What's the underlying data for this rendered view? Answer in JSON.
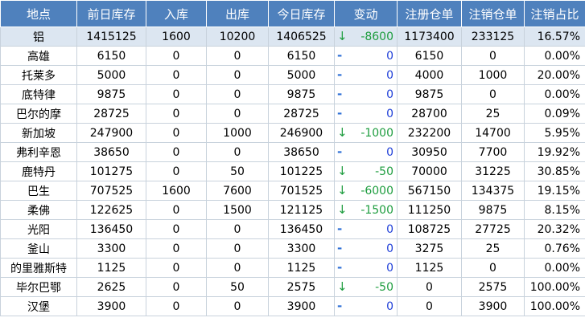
{
  "colors": {
    "header_bg": "#4f81bd",
    "header_text": "#ffffff",
    "highlight_row_bg": "#dce6f1",
    "grid_line": "#c8d2dc",
    "decrease_green": "#1e9d3f",
    "zero_blue": "#1f3fd8"
  },
  "headers": [
    "地点",
    "前日库存",
    "入库",
    "出库",
    "今日库存",
    "变动",
    "注册仓单",
    "注销仓单",
    "注销占比"
  ],
  "rows": [
    {
      "location": "铝",
      "prev": "1415125",
      "in": "1600",
      "out": "10200",
      "today": "1406525",
      "arrow": "↓",
      "arrow_icon": "down-arrow-icon",
      "change": "-8600",
      "registered": "1173400",
      "cancelled": "233125",
      "ratio": "16.57%"
    },
    {
      "location": "高雄",
      "prev": "6150",
      "in": "0",
      "out": "0",
      "today": "6150",
      "arrow": "-",
      "arrow_icon": "dash-icon",
      "change": "0",
      "registered": "6150",
      "cancelled": "0",
      "ratio": "0.00%"
    },
    {
      "location": "托莱多",
      "prev": "5000",
      "in": "0",
      "out": "0",
      "today": "5000",
      "arrow": "-",
      "arrow_icon": "dash-icon",
      "change": "0",
      "registered": "4000",
      "cancelled": "1000",
      "ratio": "20.00%"
    },
    {
      "location": "底特律",
      "prev": "9875",
      "in": "0",
      "out": "0",
      "today": "9875",
      "arrow": "-",
      "arrow_icon": "dash-icon",
      "change": "0",
      "registered": "9875",
      "cancelled": "0",
      "ratio": "0.00%"
    },
    {
      "location": "巴尔的摩",
      "prev": "28725",
      "in": "0",
      "out": "0",
      "today": "28725",
      "arrow": "-",
      "arrow_icon": "dash-icon",
      "change": "0",
      "registered": "28700",
      "cancelled": "25",
      "ratio": "0.09%"
    },
    {
      "location": "新加坡",
      "prev": "247900",
      "in": "0",
      "out": "1000",
      "today": "246900",
      "arrow": "↓",
      "arrow_icon": "down-arrow-icon",
      "change": "-1000",
      "registered": "232200",
      "cancelled": "14700",
      "ratio": "5.95%"
    },
    {
      "location": "弗利辛恩",
      "prev": "38650",
      "in": "0",
      "out": "0",
      "today": "38650",
      "arrow": "-",
      "arrow_icon": "dash-icon",
      "change": "0",
      "registered": "30950",
      "cancelled": "7700",
      "ratio": "19.92%"
    },
    {
      "location": "鹿特丹",
      "prev": "101275",
      "in": "0",
      "out": "50",
      "today": "101225",
      "arrow": "↓",
      "arrow_icon": "down-arrow-icon",
      "change": "-50",
      "registered": "70000",
      "cancelled": "31225",
      "ratio": "30.85%"
    },
    {
      "location": "巴生",
      "prev": "707525",
      "in": "1600",
      "out": "7600",
      "today": "701525",
      "arrow": "↓",
      "arrow_icon": "down-arrow-icon",
      "change": "-6000",
      "registered": "567150",
      "cancelled": "134375",
      "ratio": "19.15%"
    },
    {
      "location": "柔佛",
      "prev": "122625",
      "in": "0",
      "out": "1500",
      "today": "121125",
      "arrow": "↓",
      "arrow_icon": "down-arrow-icon",
      "change": "-1500",
      "registered": "111250",
      "cancelled": "9875",
      "ratio": "8.15%"
    },
    {
      "location": "光阳",
      "prev": "136450",
      "in": "0",
      "out": "0",
      "today": "136450",
      "arrow": "-",
      "arrow_icon": "dash-icon",
      "change": "0",
      "registered": "108725",
      "cancelled": "27725",
      "ratio": "20.32%"
    },
    {
      "location": "釜山",
      "prev": "3300",
      "in": "0",
      "out": "0",
      "today": "3300",
      "arrow": "-",
      "arrow_icon": "dash-icon",
      "change": "0",
      "registered": "3275",
      "cancelled": "25",
      "ratio": "0.76%"
    },
    {
      "location": "的里雅斯特",
      "prev": "1125",
      "in": "0",
      "out": "0",
      "today": "1125",
      "arrow": "-",
      "arrow_icon": "dash-icon",
      "change": "0",
      "registered": "1125",
      "cancelled": "0",
      "ratio": "0.00%"
    },
    {
      "location": "毕尔巴鄂",
      "prev": "2625",
      "in": "0",
      "out": "50",
      "today": "2575",
      "arrow": "↓",
      "arrow_icon": "down-arrow-icon",
      "change": "-50",
      "registered": "0",
      "cancelled": "2575",
      "ratio": "100.00%"
    },
    {
      "location": "汉堡",
      "prev": "3900",
      "in": "0",
      "out": "0",
      "today": "3900",
      "arrow": "-",
      "arrow_icon": "dash-icon",
      "change": "0",
      "registered": "0",
      "cancelled": "3900",
      "ratio": "100.00%"
    }
  ]
}
